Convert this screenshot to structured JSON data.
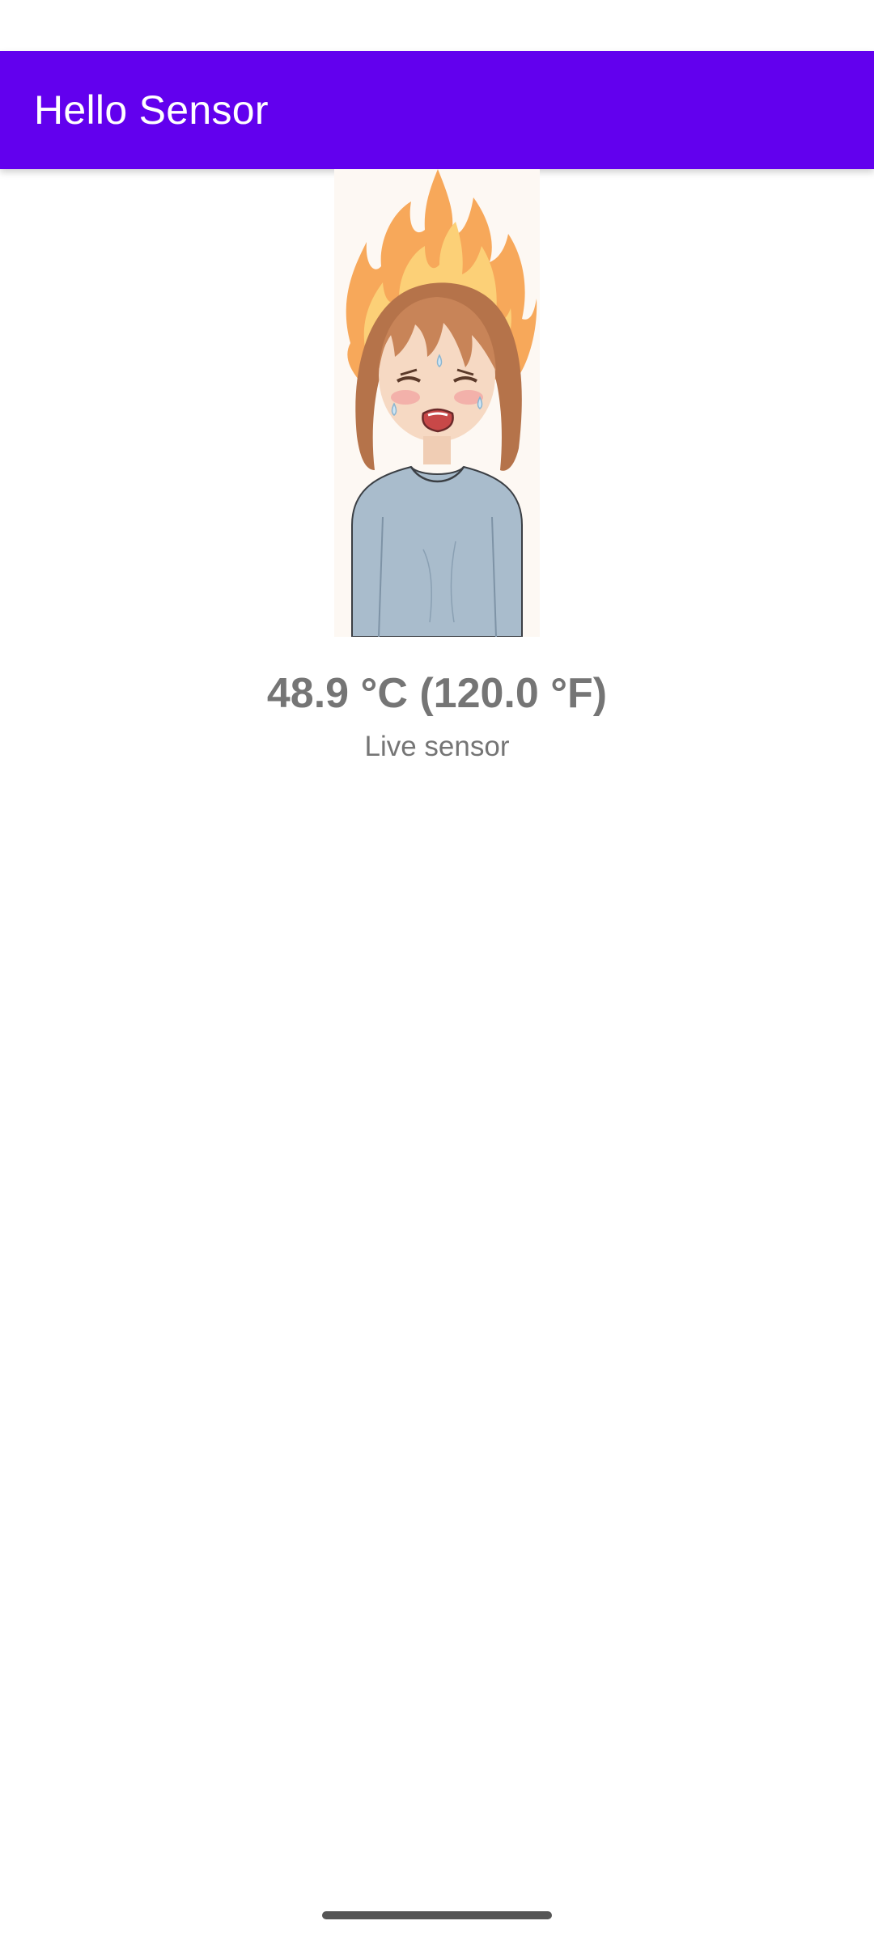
{
  "app_bar": {
    "title": "Hello Sensor",
    "color": "#6200EE"
  },
  "illustration": {
    "icon": "overheated-girl-illustration"
  },
  "reading": {
    "temperature": "48.9 °C (120.0 °F)",
    "source_label": "Live sensor"
  }
}
